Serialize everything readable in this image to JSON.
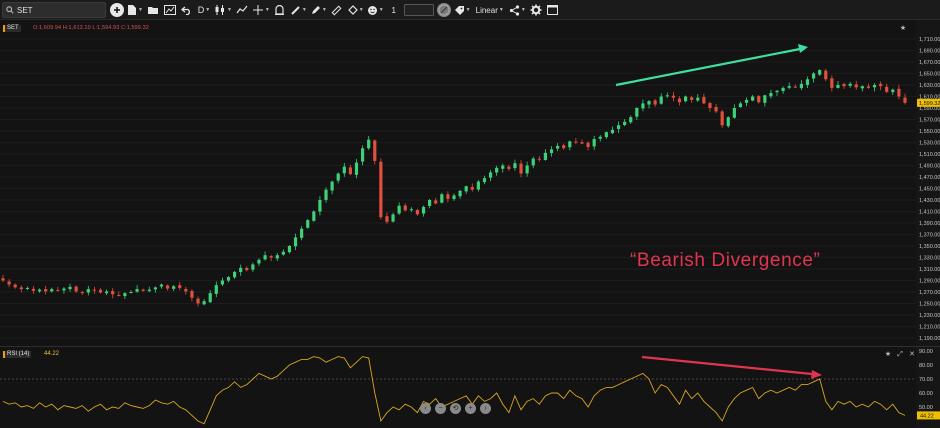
{
  "toolbar": {
    "search_value": "SET",
    "interval_label": "D",
    "line_width_value": "1",
    "scale_mode_label": "Linear",
    "icons": [
      "search-icon",
      "add-circle-icon",
      "new-file-icon",
      "open-folder-icon",
      "chart-image-icon",
      "undo-icon",
      "interval-dropdown",
      "candle-style-icon",
      "trend-line-icon",
      "crosshair-icon",
      "alert-icon",
      "brush-icon",
      "pencil-icon",
      "ruler-icon",
      "paint-bucket-icon",
      "emoji-icon",
      "line-width-box",
      "color-picker-icon",
      "tag-icon",
      "share-icon",
      "settings-gear-icon",
      "window-icon"
    ]
  },
  "main_pane": {
    "symbol": "SET",
    "ohlc_text": "O:1,609.94  H:1,613.10  L:1,594.93  C:1,599.32",
    "annotation_text": "“Bearish Divergence”",
    "last_price_label": "1,599.32",
    "price_axis_labels": [
      "1,710.00",
      "1,690.00",
      "1,670.00",
      "1,650.00",
      "1,630.00",
      "1,610.00",
      "1,590.00",
      "1,570.00",
      "1,550.00",
      "1,530.00",
      "1,510.00",
      "1,490.00",
      "1,470.00",
      "1,450.00",
      "1,430.00",
      "1,410.00",
      "1,390.00",
      "1,370.00",
      "1,350.00",
      "1,330.00",
      "1,310.00",
      "1,290.00",
      "1,270.00",
      "1,250.00",
      "1,230.00",
      "1,210.00",
      "1,190.00"
    ]
  },
  "rsi_pane": {
    "label": "RSI (14)",
    "value": "44.22",
    "axis_labels": [
      "90.00",
      "80.00",
      "70.00",
      "60.00",
      "50.00"
    ],
    "last_value_label": "44.22"
  },
  "colors": {
    "background": "#131313",
    "up_candle": "#3dd17a",
    "down_candle": "#e0503c",
    "rsi_line": "#d7a520",
    "green_arrow": "#3ee0a0",
    "red_arrow": "#e0354f",
    "price_tag": "#f0c000"
  },
  "chart_data": [
    {
      "type": "candlestick",
      "series": [
        {
          "name": "SET"
        }
      ],
      "close_approx": [
        1290,
        1283,
        1278,
        1275,
        1277,
        1272,
        1274,
        1271,
        1275,
        1273,
        1276,
        1279,
        1271,
        1268,
        1275,
        1273,
        1269,
        1271,
        1266,
        1264,
        1268,
        1270,
        1275,
        1272,
        1274,
        1278,
        1283,
        1276,
        1280,
        1277,
        1271,
        1260,
        1250,
        1254,
        1268,
        1282,
        1290,
        1296,
        1305,
        1312,
        1308,
        1318,
        1326,
        1334,
        1330,
        1334,
        1340,
        1350,
        1365,
        1380,
        1395,
        1410,
        1430,
        1448,
        1462,
        1476,
        1488,
        1475,
        1495,
        1520,
        1535,
        1498,
        1400,
        1392,
        1405,
        1420,
        1412,
        1414,
        1405,
        1418,
        1430,
        1424,
        1440,
        1432,
        1438,
        1446,
        1454,
        1448,
        1462,
        1468,
        1478,
        1486,
        1490,
        1484,
        1494,
        1476,
        1490,
        1502,
        1500,
        1512,
        1518,
        1524,
        1520,
        1532,
        1530,
        1528,
        1522,
        1536,
        1540,
        1548,
        1552,
        1560,
        1566,
        1574,
        1590,
        1598,
        1602,
        1596,
        1610,
        1612,
        1608,
        1600,
        1610,
        1604,
        1608,
        1598,
        1590,
        1584,
        1560,
        1574,
        1590,
        1598,
        1604,
        1610,
        1600,
        1612,
        1616,
        1620,
        1625,
        1628,
        1626,
        1632,
        1640,
        1650,
        1656,
        1640,
        1625,
        1630,
        1628,
        1632,
        1626,
        1628,
        1625,
        1630,
        1628,
        1618,
        1622,
        1610,
        1599
      ],
      "y_axis_range": [
        1190,
        1710
      ],
      "scale": "linear"
    },
    {
      "type": "line",
      "series": [
        {
          "name": "RSI (14)"
        }
      ],
      "values_approx": [
        54,
        52,
        53,
        50,
        51,
        49,
        53,
        50,
        52,
        48,
        51,
        50,
        49,
        51,
        47,
        50,
        52,
        48,
        50,
        49,
        53,
        51,
        50,
        49,
        51,
        55,
        53,
        52,
        54,
        50,
        48,
        44,
        40,
        38,
        48,
        58,
        62,
        64,
        68,
        64,
        66,
        70,
        74,
        72,
        70,
        72,
        76,
        80,
        82,
        84,
        84,
        86,
        85,
        82,
        84,
        86,
        85,
        78,
        82,
        86,
        85,
        60,
        40,
        46,
        50,
        48,
        52,
        50,
        46,
        54,
        52,
        56,
        50,
        52,
        54,
        56,
        58,
        52,
        58,
        54,
        56,
        60,
        52,
        46,
        58,
        48,
        54,
        56,
        52,
        58,
        60,
        60,
        56,
        62,
        58,
        56,
        50,
        58,
        62,
        64,
        64,
        66,
        68,
        70,
        72,
        74,
        70,
        60,
        66,
        64,
        58,
        52,
        62,
        56,
        60,
        54,
        50,
        46,
        40,
        50,
        56,
        60,
        62,
        64,
        56,
        60,
        62,
        60,
        62,
        64,
        62,
        66,
        66,
        68,
        70,
        54,
        48,
        54,
        52,
        54,
        50,
        52,
        50,
        54,
        52,
        48,
        52,
        46,
        44
      ],
      "y_axis_range": [
        40,
        90
      ],
      "reference_lines": [
        70
      ]
    }
  ]
}
